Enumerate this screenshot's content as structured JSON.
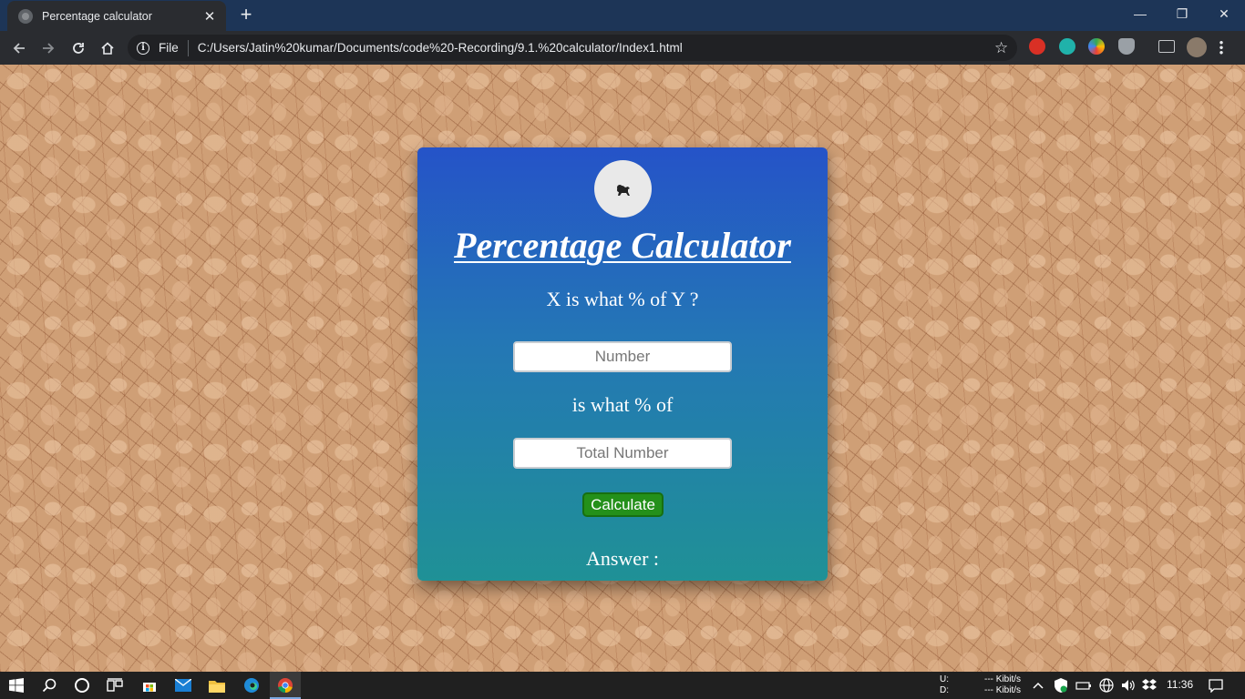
{
  "browser": {
    "tab_title": "Percentage calculator",
    "tab_close": "✕",
    "new_tab": "+",
    "scheme_label": "File",
    "url": "C:/Users/Jatin%20kumar/Documents/code%20-Recording/9.1.%20calculator/Index1.html"
  },
  "window_controls": {
    "minimize": "—",
    "restore": "❐",
    "close": "✕"
  },
  "app": {
    "title": "Percentage Calculator",
    "question": "X is what % of Y ?",
    "input_x": {
      "placeholder": "Number",
      "value": ""
    },
    "connector": "is what % of",
    "input_y": {
      "placeholder": "Total Number",
      "value": ""
    },
    "calculate_label": "Calculate",
    "answer_label": "Answer :",
    "logo_icon": "lion-icon"
  },
  "taskbar": {
    "net_up_label": "U:",
    "net_down_label": "D:",
    "net_up_value": "--- Kibit/s",
    "net_down_value": "--- Kibit/s",
    "time": "11:36"
  },
  "colors": {
    "card_top": "#2553c8",
    "card_bottom": "#1f9196",
    "calculate_button": "#24901a",
    "background": "#cf9f76"
  }
}
